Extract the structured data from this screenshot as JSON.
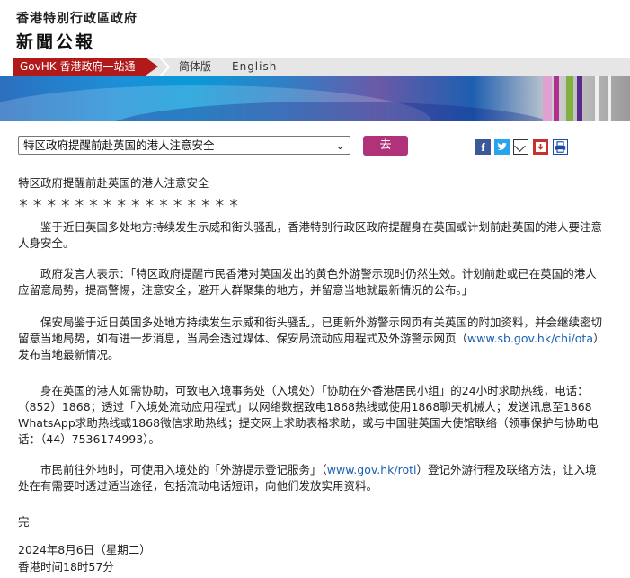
{
  "masthead": {
    "government": "香港特別行政區政府",
    "press_release": "新聞公報"
  },
  "nav": {
    "govhk_link": "GovHK 香港政府一站通",
    "simplified": "简体版",
    "english": "English"
  },
  "toolbar": {
    "selected_title": "特区政府提醒前赴英国的港人注意安全",
    "go_label": "去",
    "share_icons": [
      "facebook-icon",
      "twitter-icon",
      "email-icon",
      "save-icon",
      "print-icon"
    ]
  },
  "article": {
    "heading": "特区政府提醒前赴英国的港人注意安全",
    "stars": "＊＊＊＊＊＊＊＊＊＊＊＊＊＊＊＊",
    "p1": "鉴于近日英国多处地方持续发生示威和街头骚乱，香港特别行政区政府提醒身在英国或计划前赴英国的港人要注意人身安全。",
    "p2": "政府发言人表示：「特区政府提醒市民香港对英国发出的黄色外游警示现时仍然生效。计划前赴或已在英国的港人应留意局势，提高警惕，注意安全，避开人群聚集的地方，并留意当地就最新情况的公布。」",
    "p3_before": "保安局鉴于近日英国多处地方持续发生示威和街头骚乱，已更新外游警示网页有关英国的附加资料，并会继续密切留意当地局势，如有进一步消息，当局会透过媒体、保安局流动应用程式及外游警示网页（",
    "p3_link": "www.sb.gov.hk/chi/ota",
    "p3_after": "）发布当地最新情况。",
    "p4": "身在英国的港人如需协助，可致电入境事务处（入境处）「协助在外香港居民小组」的24小时求助热线，电话：（852）1868；透过「入境处流动应用程式」以网络数据致电1868热线或使用1868聊天机械人；发送讯息至1868 WhatsApp求助热线或1868微信求助热线；提交网上求助表格求助，或与中国驻英国大使馆联络（领事保护与协助电话：（44）7536174993）。",
    "p5_before": "市民前往外地时，可使用入境处的「外游提示登记服务」（",
    "p5_link": "www.gov.hk/roti",
    "p5_after": "）登记外游行程及联络方法，让入境处在有需要时透过适当途径，包括流动电话短讯，向他们发放实用资料。",
    "end": "完",
    "date": "2024年8月6日（星期二）",
    "time": "香港时间18时57分"
  }
}
